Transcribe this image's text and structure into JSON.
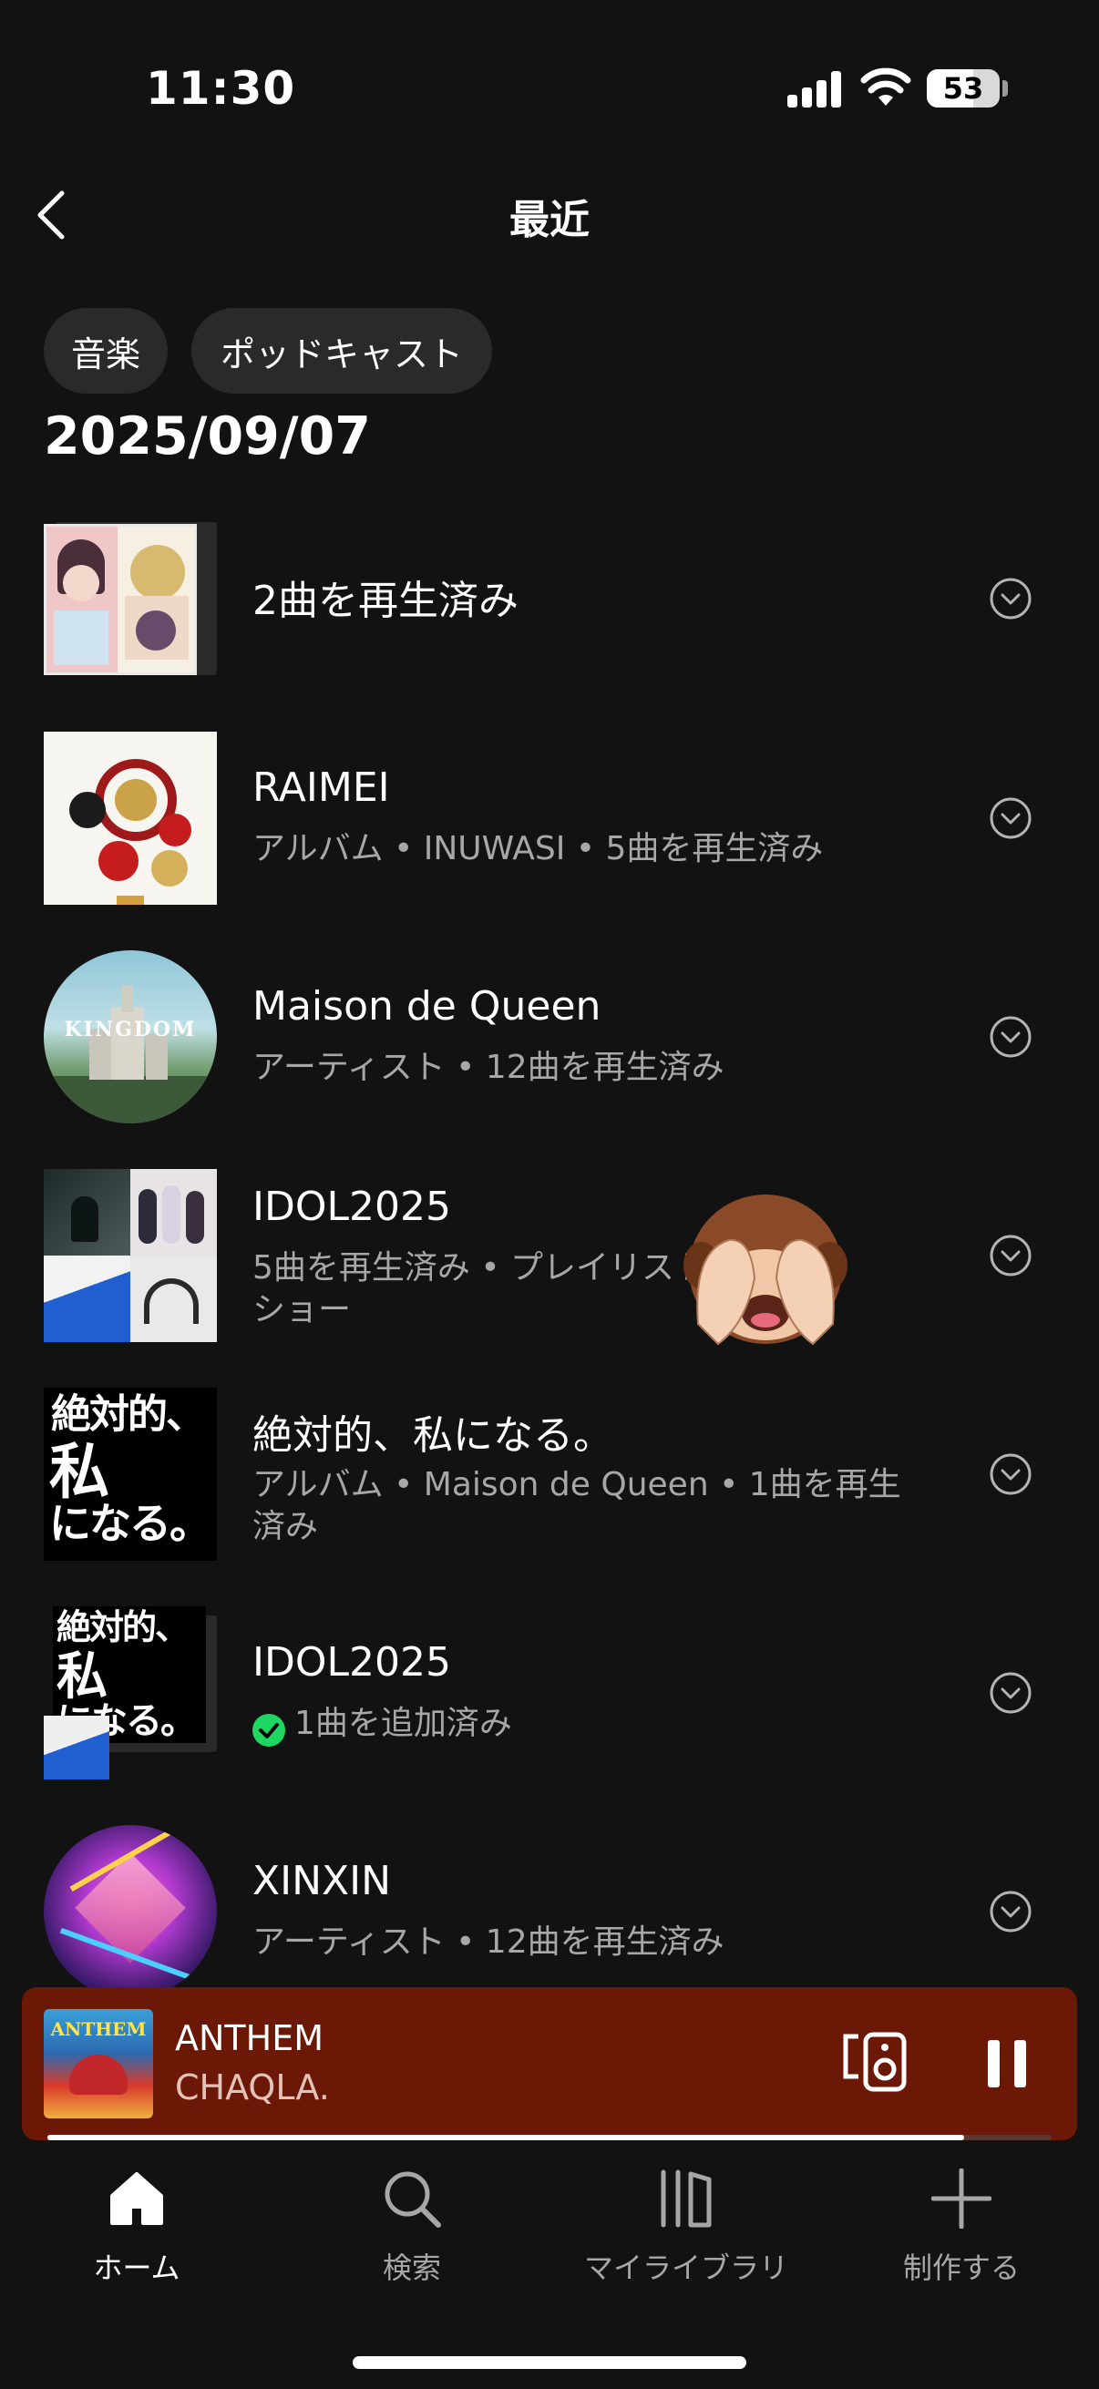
{
  "status_bar": {
    "time": "11:30",
    "battery": "53"
  },
  "header": {
    "title": "最近"
  },
  "filters": {
    "music": "音楽",
    "podcast": "ポッドキャスト"
  },
  "date_heading": "2025/09/07",
  "items": [
    {
      "title": "2曲を再生済み",
      "subtitle": ""
    },
    {
      "title": "RAIMEI",
      "subtitle": "アルバム • INUWASI • 5曲を再生済み"
    },
    {
      "title": "Maison de Queen",
      "subtitle": "アーティスト • 12曲を再生済み"
    },
    {
      "title": "IDOL2025",
      "subtitle": "5曲を再生済み • プレイリスト\nショー"
    },
    {
      "title": "絶対的、私になる。",
      "subtitle": "アルバム • Maison de Queen • 1曲を再生\n済み"
    },
    {
      "title": "IDOL2025",
      "subtitle": "1曲を追加済み"
    },
    {
      "title": "XINXIN",
      "subtitle": "アーティスト • 12曲を再生済み"
    }
  ],
  "art_text": {
    "kingdom": "KINGDOM",
    "zettai_1": "絶対的、",
    "zettai_2": "私",
    "zettai_3": "になる。",
    "anthem": "ANTHEM"
  },
  "player": {
    "title": "ANTHEM",
    "artist": "CHAQLA.",
    "progress": 0.913
  },
  "nav": {
    "home": "ホーム",
    "search": "検索",
    "library": "マイライブラリ",
    "create": "制作する"
  },
  "colors": {
    "background": "#121212",
    "player_bg": "#6b1806",
    "check_green": "#1ed760",
    "chip_bg": "#2a2a2a"
  }
}
